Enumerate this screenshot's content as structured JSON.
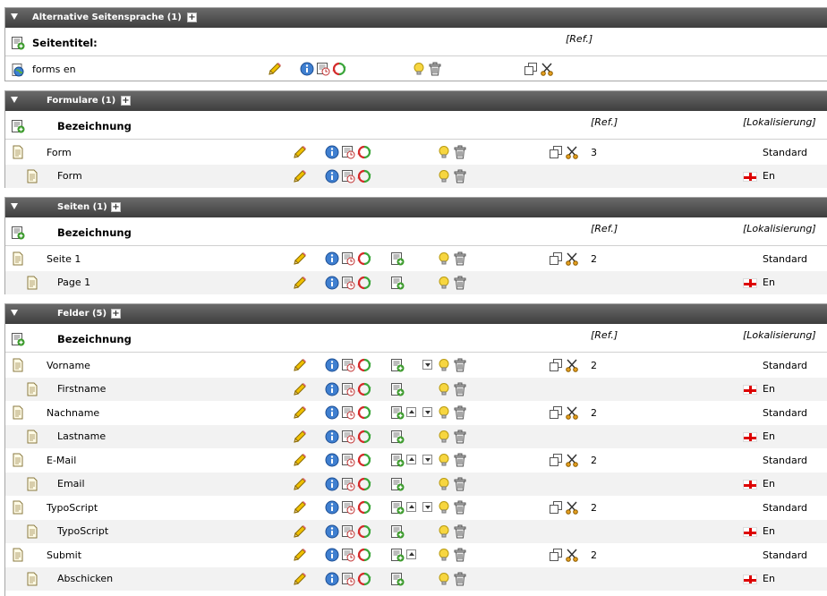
{
  "colors": {
    "header_bg": "#4f4f4f",
    "header_text": "#ffffff",
    "alt_row": "#f2f2f2"
  },
  "sections": {
    "alt": {
      "title": "Alternative Seitensprache (1)",
      "col_title": "Seitentitel:",
      "col_ref": "[Ref.]",
      "rows": [
        {
          "title": "forms en"
        }
      ]
    },
    "formulare": {
      "title": "Formulare (1)",
      "col_title": "Bezeichnung",
      "col_ref": "[Ref.]",
      "col_loc": "[Lokalisierung]",
      "rows": [
        {
          "title": "Form",
          "ref": "3",
          "loc": "Standard"
        },
        {
          "title": "Form",
          "loc": "En"
        }
      ]
    },
    "seiten": {
      "title": "Seiten (1)",
      "col_title": "Bezeichnung",
      "col_ref": "[Ref.]",
      "col_loc": "[Lokalisierung]",
      "rows": [
        {
          "title": "Seite 1",
          "ref": "2",
          "loc": "Standard"
        },
        {
          "title": "Page 1",
          "loc": "En"
        }
      ]
    },
    "felder": {
      "title": "Felder (5)",
      "col_title": "Bezeichnung",
      "col_ref": "[Ref.]",
      "col_loc": "[Lokalisierung]",
      "rows": [
        {
          "title": "Vorname",
          "ref": "2",
          "loc": "Standard"
        },
        {
          "title": "Firstname",
          "loc": "En"
        },
        {
          "title": "Nachname",
          "ref": "2",
          "loc": "Standard"
        },
        {
          "title": "Lastname",
          "loc": "En"
        },
        {
          "title": "E-Mail",
          "ref": "2",
          "loc": "Standard"
        },
        {
          "title": "Email",
          "loc": "En"
        },
        {
          "title": "TypoScript",
          "ref": "2",
          "loc": "Standard"
        },
        {
          "title": "TypoScript",
          "loc": "En"
        },
        {
          "title": "Submit",
          "ref": "2",
          "loc": "Standard"
        },
        {
          "title": "Abschicken",
          "loc": "En"
        }
      ]
    }
  },
  "icons": {
    "collapse": "triangle-down-icon",
    "expand": "plus-icon",
    "new_record": "new-record-icon",
    "page": "page-icon",
    "translated_page": "translated-page-icon",
    "web_page": "globe-page-icon",
    "edit": "pencil-icon",
    "info": "info-icon",
    "history": "history-icon",
    "refresh": "refresh-icon",
    "new": "new-element-icon",
    "move_down": "move-down-icon",
    "move_up": "move-up-icon",
    "hide": "lightbulb-icon",
    "delete": "trash-icon",
    "copy": "copy-icon",
    "cut": "cut-icon",
    "flag": "english-flag-icon"
  }
}
